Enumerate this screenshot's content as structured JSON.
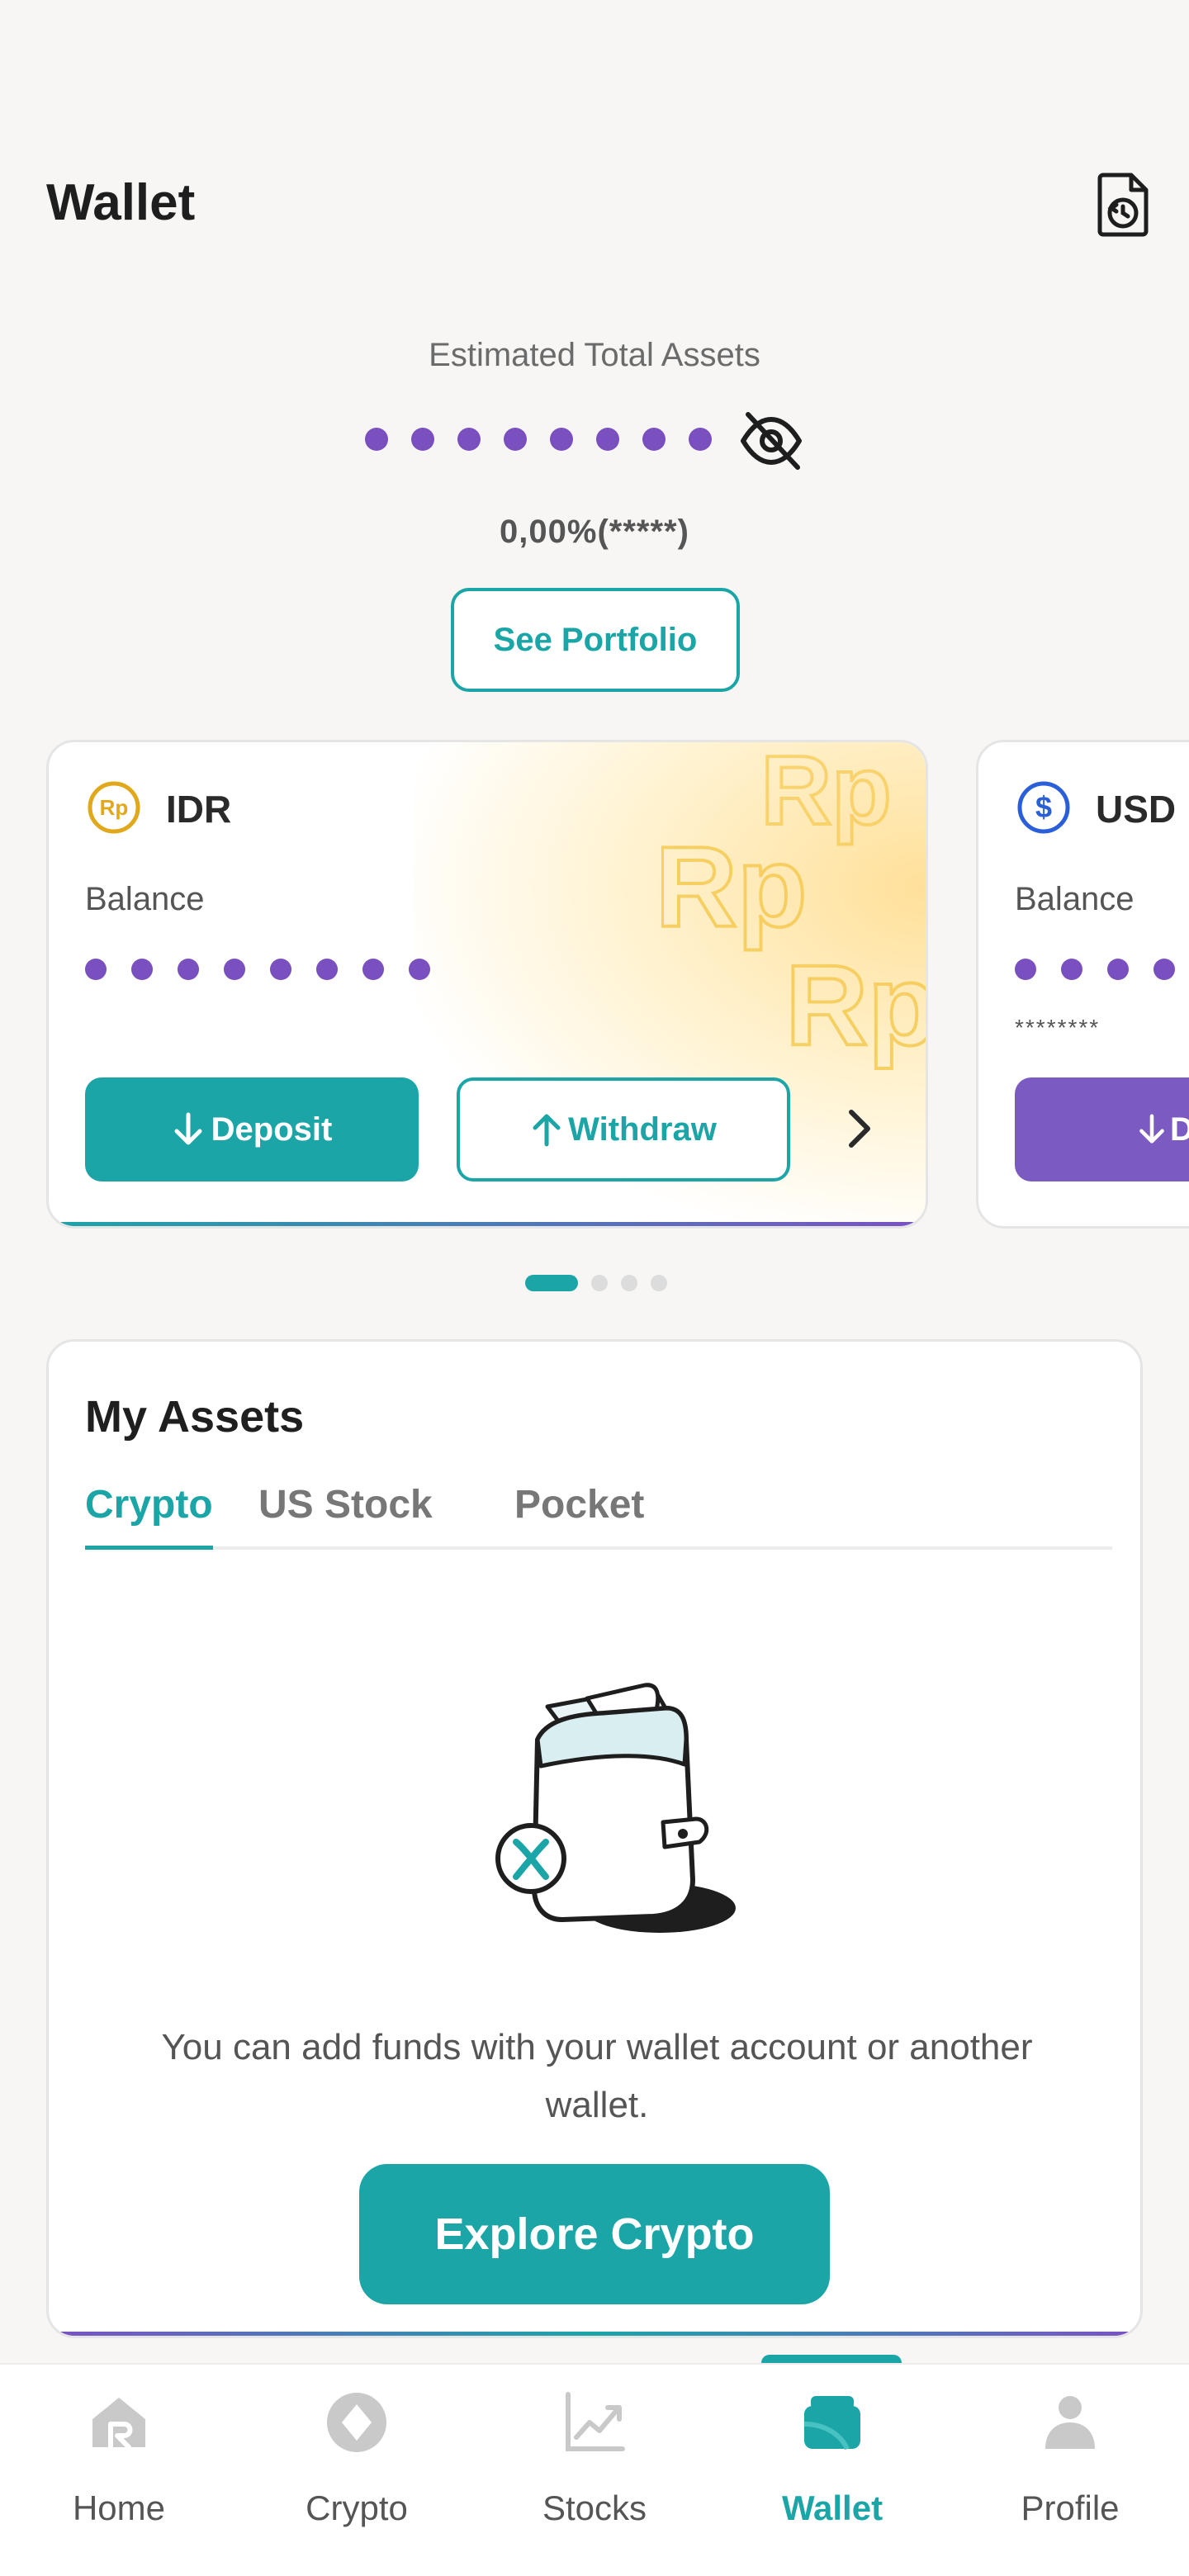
{
  "header": {
    "title": "Wallet",
    "history_icon": "transaction-history-icon"
  },
  "summary": {
    "estimated_label": "Estimated Total Assets",
    "masked_dots": 8,
    "change_text": "0,00%(*****)",
    "see_portfolio_label": "See Portfolio",
    "eye_icon": "eye-off-icon"
  },
  "wallet_cards": [
    {
      "currency": "IDR",
      "currency_icon": "rupiah-coin-icon",
      "balance_label": "Balance",
      "masked_dots": 8,
      "deposit_label": "Deposit",
      "withdraw_label": "Withdraw",
      "more_icon": "chevron-right-icon"
    },
    {
      "currency": "USD",
      "currency_icon": "dollar-coin-icon",
      "balance_label": "Balance",
      "masked_stars": "********",
      "deposit_label": "D"
    }
  ],
  "pager": {
    "count": 4,
    "active_index": 0
  },
  "assets": {
    "title": "My Assets",
    "tabs": [
      {
        "label": "Crypto",
        "active": true
      },
      {
        "label": "US Stock",
        "active": false
      },
      {
        "label": "Pocket",
        "active": false
      }
    ],
    "empty_text": "You can add funds with your wallet account or another wallet.",
    "explore_label": "Explore Crypto"
  },
  "bottom_nav": [
    {
      "label": "Home",
      "icon": "home-icon",
      "active": false
    },
    {
      "label": "Crypto",
      "icon": "crypto-icon",
      "active": false
    },
    {
      "label": "Stocks",
      "icon": "stocks-chart-icon",
      "active": false
    },
    {
      "label": "Wallet",
      "icon": "wallet-icon",
      "active": true
    },
    {
      "label": "Profile",
      "icon": "profile-icon",
      "active": false
    }
  ],
  "colors": {
    "teal": "#1ba5a7",
    "purple": "#7a4fbf",
    "gold": "#e0a81a",
    "blue": "#2b5fd9"
  }
}
